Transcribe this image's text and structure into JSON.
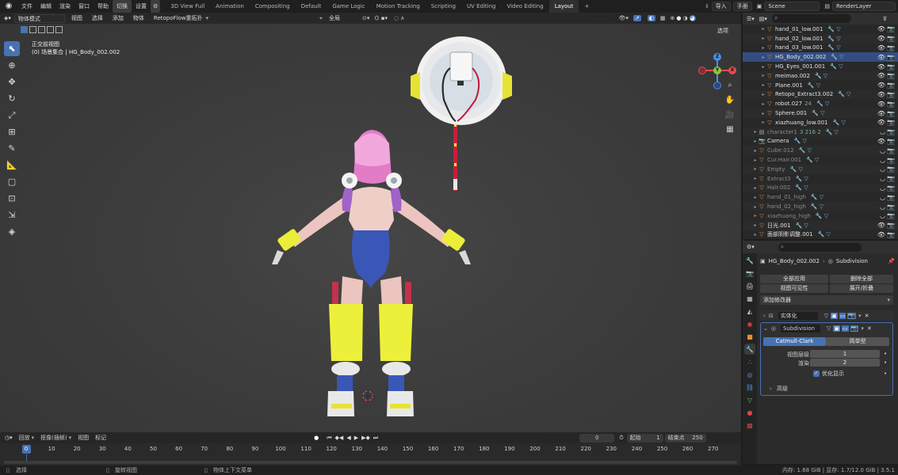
{
  "menu": {
    "items": [
      "文件",
      "编辑",
      "渲染",
      "窗口",
      "帮助"
    ],
    "switch_label": "切换",
    "settings_label": "设置"
  },
  "workspaces": [
    "3D View Full",
    "Animation",
    "Compositing",
    "Default",
    "Game Logic",
    "Motion Tracking",
    "Scripting",
    "UV Editing",
    "Video Editing",
    "Layout"
  ],
  "top_right": {
    "import_label": "导入",
    "manual_label": "手册",
    "scene": "Scene",
    "render_layer": "RenderLayer"
  },
  "viewport_header": {
    "mode": "物体模式",
    "view": "视图",
    "select": "选择",
    "add": "添加",
    "object": "物体",
    "retopo": "RetopoFlow重拓扑",
    "orientation": "全局",
    "options": "选项"
  },
  "viewport_overlay": {
    "view_name": "正交前视图",
    "collection_info": "(0) 场景集合 | HG_Body_002.002"
  },
  "gizmo": {
    "x": "X",
    "y": "Y",
    "z": "Z"
  },
  "outliner": {
    "rows": [
      {
        "name": "hand_01_low.001",
        "dim": false,
        "sel": false,
        "indent": 2
      },
      {
        "name": "hand_02_low.001",
        "dim": false,
        "sel": false,
        "indent": 2
      },
      {
        "name": "hand_03_low.001",
        "dim": false,
        "sel": false,
        "indent": 2
      },
      {
        "name": "HG_Body_002.002",
        "dim": false,
        "sel": true,
        "indent": 2
      },
      {
        "name": "HG_Eyes_001.001",
        "dim": false,
        "sel": false,
        "indent": 2
      },
      {
        "name": "meimao.002",
        "dim": false,
        "sel": false,
        "indent": 2
      },
      {
        "name": "Plane.001",
        "dim": false,
        "sel": false,
        "indent": 2
      },
      {
        "name": "Retopo_Extract3.002",
        "dim": false,
        "sel": false,
        "indent": 2
      },
      {
        "name": "robot.027",
        "dim": false,
        "sel": false,
        "indent": 2,
        "badge": "24"
      },
      {
        "name": "Sphere.001",
        "dim": false,
        "sel": false,
        "indent": 2
      },
      {
        "name": "xiazhuang_low.001",
        "dim": false,
        "sel": false,
        "indent": 2
      },
      {
        "name": "character1",
        "dim": true,
        "sel": false,
        "indent": 1,
        "badge": "3 216 2"
      },
      {
        "name": "Camera",
        "dim": false,
        "sel": false,
        "indent": 1
      },
      {
        "name": "Cube.012",
        "dim": true,
        "sel": false,
        "indent": 1
      },
      {
        "name": "Cur.Hair.001",
        "dim": true,
        "sel": false,
        "indent": 1
      },
      {
        "name": "Empty",
        "dim": true,
        "sel": false,
        "indent": 1
      },
      {
        "name": "Extract3",
        "dim": true,
        "sel": false,
        "indent": 1
      },
      {
        "name": "Hair.002",
        "dim": true,
        "sel": false,
        "indent": 1
      },
      {
        "name": "hand_01_high",
        "dim": true,
        "sel": false,
        "indent": 1
      },
      {
        "name": "hand_02_high",
        "dim": true,
        "sel": false,
        "indent": 1
      },
      {
        "name": "xiazhuang_high",
        "dim": true,
        "sel": false,
        "indent": 1
      },
      {
        "name": "日光.001",
        "dim": false,
        "sel": false,
        "indent": 1
      },
      {
        "name": "面部阴影调整.001",
        "dim": false,
        "sel": false,
        "indent": 1
      }
    ]
  },
  "properties": {
    "breadcrumb_object": "HG_Body_002.002",
    "breadcrumb_modifier": "Subdivision",
    "apply_all": "全部应用",
    "delete_all": "删除全部",
    "viewport_visibility": "视图可见性",
    "expand_collapse": "展开/折叠",
    "add_modifier": "添加修改器",
    "modifier1_name": "实体化",
    "modifier2_name": "Subdivision",
    "catmull_clark": "Catmull-Clark",
    "simple": "简单型",
    "viewport_levels_label": "视图层级",
    "viewport_levels_value": "1",
    "render_label": "渲染",
    "render_value": "2",
    "optimal_display": "优化显示",
    "advanced": "高级"
  },
  "timeline": {
    "playback": "回放",
    "keying": "抠像(插帧)",
    "view": "视图",
    "marker": "标记",
    "current_frame": "0",
    "start_label": "起始",
    "start_value": "1",
    "end_label": "结束点",
    "end_value": "250",
    "ticks": [
      "0",
      "10",
      "20",
      "30",
      "40",
      "50",
      "60",
      "70",
      "80",
      "90",
      "100",
      "110",
      "120",
      "130",
      "140",
      "150",
      "160",
      "170",
      "180",
      "190",
      "200",
      "210",
      "220",
      "230",
      "240",
      "250",
      "260",
      "270"
    ]
  },
  "status": {
    "select": "选择",
    "rotate_view": "旋转视图",
    "context_menu": "物体上下文菜单",
    "memory": "内存: 1.68 GiB | 显存: 1.7/12.0 GiB | 3.5.1"
  },
  "colors": {
    "accent": "#4772b3",
    "selected_row": "#334d80",
    "axis_x": "#e84a55",
    "axis_y": "#8bc43c",
    "axis_z": "#4a8ee8"
  }
}
